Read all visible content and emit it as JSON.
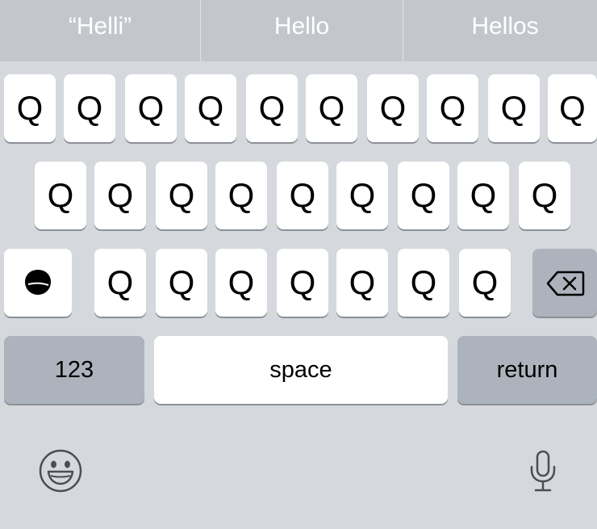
{
  "suggestions": [
    {
      "label": "“Helli”"
    },
    {
      "label": "Hello"
    },
    {
      "label": "Hellos"
    }
  ],
  "rows": [
    [
      "Q",
      "Q",
      "Q",
      "Q",
      "Q",
      "Q",
      "Q",
      "Q",
      "Q",
      "Q"
    ],
    [
      "Q",
      "Q",
      "Q",
      "Q",
      "Q",
      "Q",
      "Q",
      "Q",
      "Q"
    ],
    [
      "Q",
      "Q",
      "Q",
      "Q",
      "Q",
      "Q",
      "Q"
    ]
  ],
  "bottom_row": {
    "numbers_label": "123",
    "space_label": "space",
    "return_label": "return"
  },
  "icons": {
    "shift": "shift-icon",
    "backspace": "backspace-icon",
    "emoji": "emoji-icon",
    "microphone": "microphone-icon"
  },
  "colors": {
    "keyboard_bg": "#d5d8dd",
    "suggestion_bar_bg": "#c3c7cd",
    "key_bg": "#ffffff",
    "special_key_bg": "#acb3bc"
  }
}
